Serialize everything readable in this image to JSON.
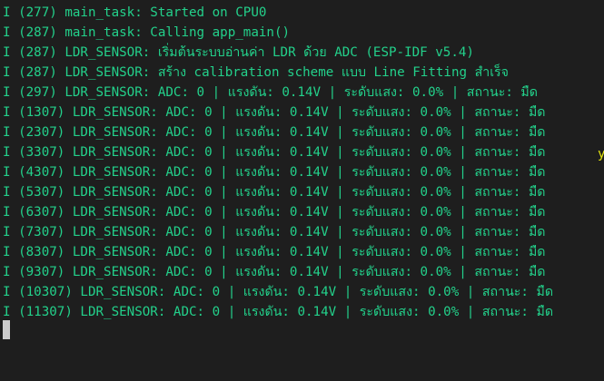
{
  "terminal": {
    "lines": [
      "I (277) main_task: Started on CPU0",
      "I (287) main_task: Calling app_main()",
      "I (287) LDR_SENSOR: เริ่มต้นระบบอ่านค่า LDR ด้วย ADC (ESP-IDF v5.4)",
      "I (287) LDR_SENSOR: สร้าง calibration scheme แบบ Line Fitting สำเร็จ",
      "I (297) LDR_SENSOR: ADC: 0 | แรงดัน: 0.14V | ระดับแสง: 0.0% | สถานะ: มืด",
      "I (1307) LDR_SENSOR: ADC: 0 | แรงดัน: 0.14V | ระดับแสง: 0.0% | สถานะ: มืด",
      "I (2307) LDR_SENSOR: ADC: 0 | แรงดัน: 0.14V | ระดับแสง: 0.0% | สถานะ: มืด",
      "I (3307) LDR_SENSOR: ADC: 0 | แรงดัน: 0.14V | ระดับแสง: 0.0% | สถานะ: มืด",
      "I (4307) LDR_SENSOR: ADC: 0 | แรงดัน: 0.14V | ระดับแสง: 0.0% | สถานะ: มืด",
      "I (5307) LDR_SENSOR: ADC: 0 | แรงดัน: 0.14V | ระดับแสง: 0.0% | สถานะ: มืด",
      "I (6307) LDR_SENSOR: ADC: 0 | แรงดัน: 0.14V | ระดับแสง: 0.0% | สถานะ: มืด",
      "I (7307) LDR_SENSOR: ADC: 0 | แรงดัน: 0.14V | ระดับแสง: 0.0% | สถานะ: มืด",
      "I (8307) LDR_SENSOR: ADC: 0 | แรงดัน: 0.14V | ระดับแสง: 0.0% | สถานะ: มืด",
      "I (9307) LDR_SENSOR: ADC: 0 | แรงดัน: 0.14V | ระดับแสง: 0.0% | สถานะ: มืด",
      "I (10307) LDR_SENSOR: ADC: 0 | แรงดัน: 0.14V | ระดับแสง: 0.0% | สถานะ: มืด",
      "I (11307) LDR_SENSOR: ADC: 0 | แรงดัน: 0.14V | ระดับแสง: 0.0% | สถานะ: มืด"
    ],
    "stray_char": "y"
  },
  "colors": {
    "background": "#1e1e1e",
    "log_text": "#23d18b",
    "stray_char": "#e5e510",
    "cursor": "#cccccc"
  }
}
